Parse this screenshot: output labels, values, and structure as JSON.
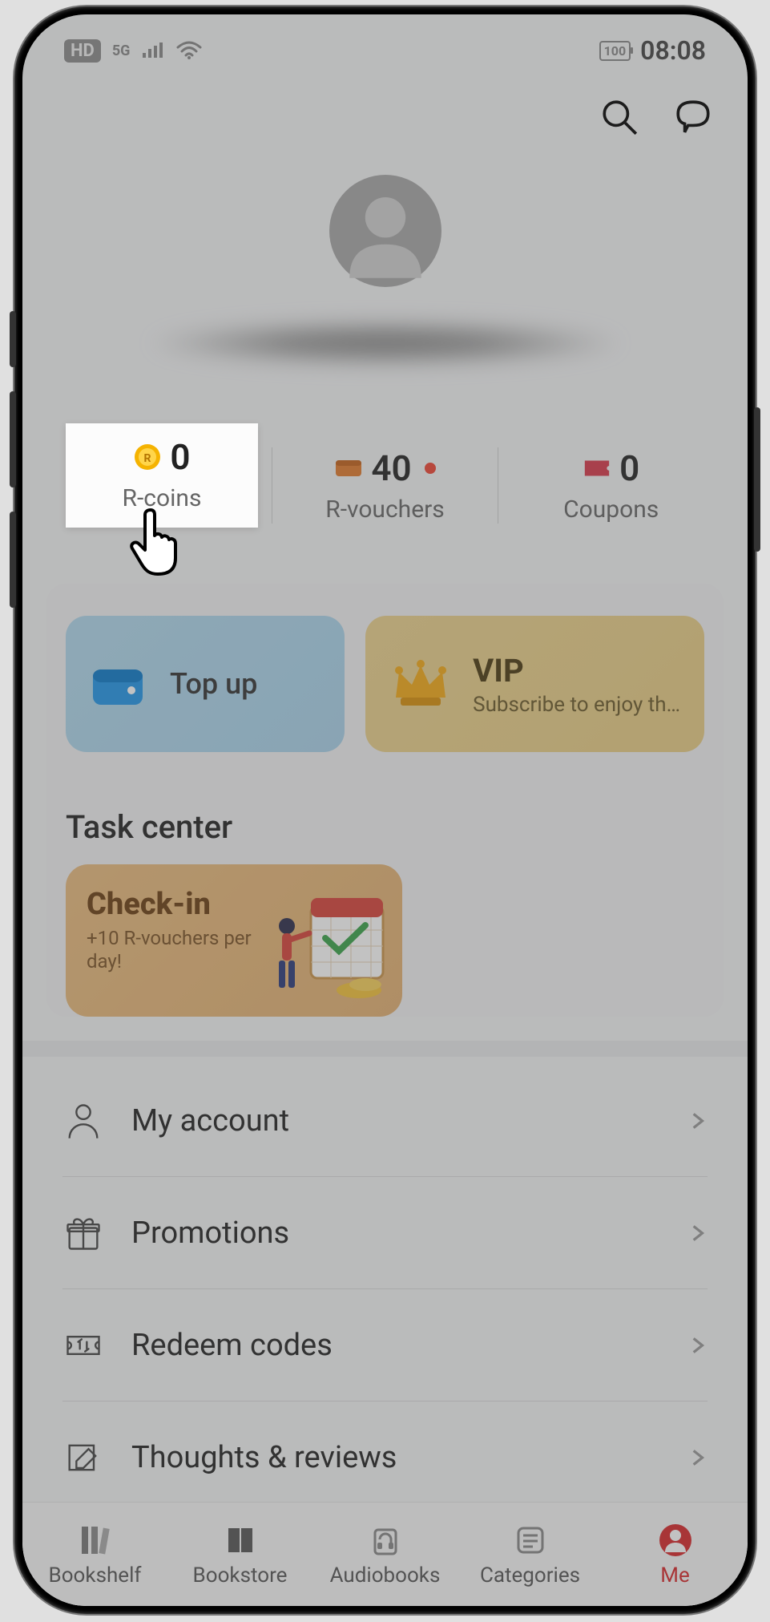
{
  "status": {
    "hd": "HD",
    "net": "5G",
    "battery": "100",
    "time": "08:08"
  },
  "wallet": {
    "rcoins": {
      "value": "0",
      "label": "R-coins"
    },
    "rvouchers": {
      "value": "40",
      "label": "R-vouchers",
      "has_dot": true
    },
    "coupons": {
      "value": "0",
      "label": "Coupons"
    }
  },
  "cards": {
    "topup": {
      "title": "Top up"
    },
    "vip": {
      "title": "VIP",
      "subtitle": "Subscribe to enjoy th…"
    }
  },
  "task": {
    "header": "Task center",
    "checkin": {
      "title": "Check-in",
      "subtitle": "+10 R-vouchers per day!"
    }
  },
  "menu": {
    "account": "My account",
    "promotions": "Promotions",
    "redeem": "Redeem codes",
    "thoughts": "Thoughts & reviews"
  },
  "tabs": {
    "bookshelf": "Bookshelf",
    "bookstore": "Bookstore",
    "audiobooks": "Audiobooks",
    "categories": "Categories",
    "me": "Me"
  },
  "colors": {
    "accent_red": "#d8272a",
    "coin_gold": "#f5b301",
    "voucher_orange": "#e07a2c",
    "coupon_red": "#d8384a"
  }
}
